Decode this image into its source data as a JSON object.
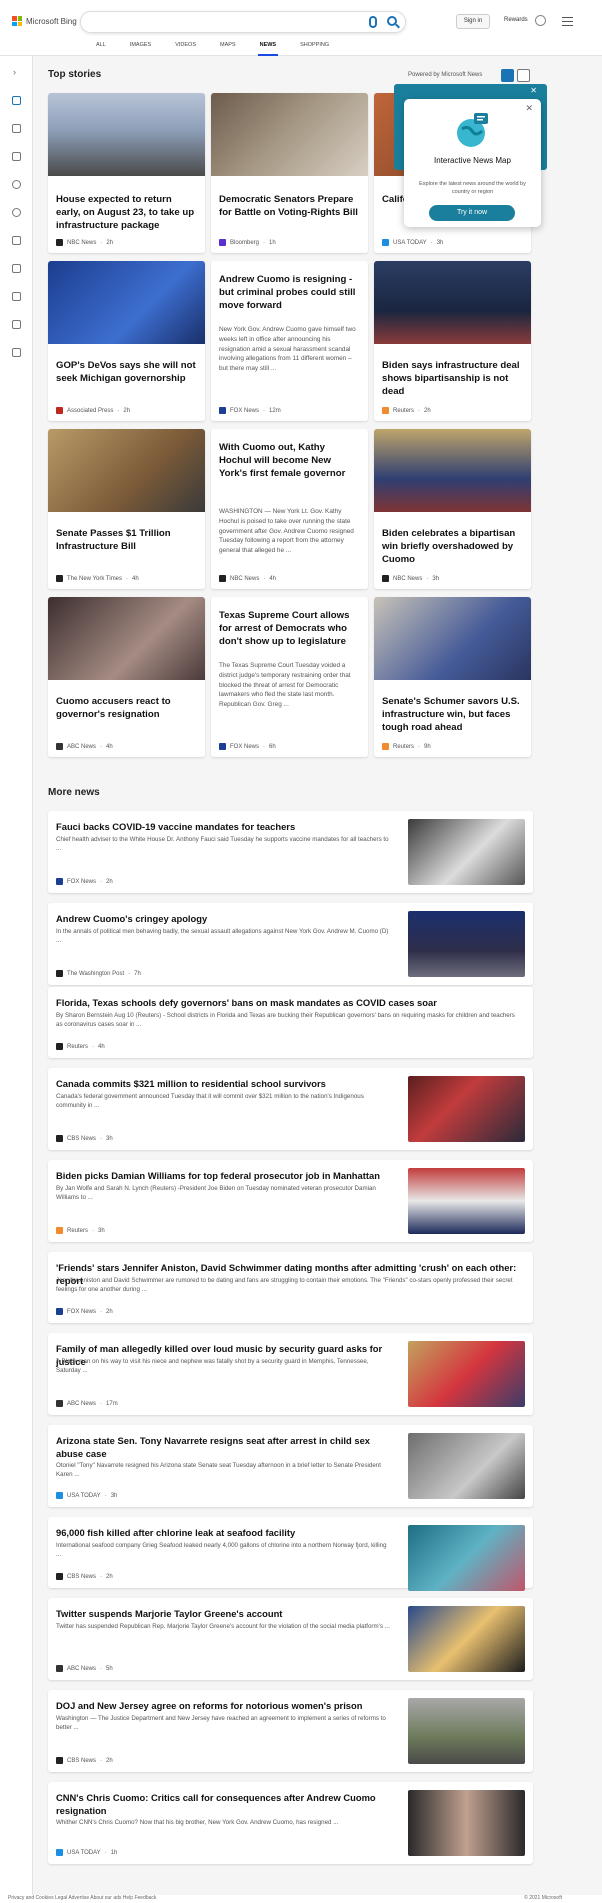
{
  "header": {
    "brand": "Microsoft Bing",
    "signin": "Sign in",
    "rewards": "Rewards",
    "tabs": [
      "ALL",
      "IMAGES",
      "VIDEOS",
      "MAPS",
      "NEWS",
      "SHOPPING"
    ],
    "active_tab": "NEWS"
  },
  "top_stories": {
    "heading": "Top stories",
    "powered_by": "Powered by Microsoft News",
    "cards": [
      {
        "title": "House expected to return early, on August 23, to take up infrastructure package",
        "snippet": "",
        "source": "NBC News",
        "age": "2h",
        "src_color": "#222"
      },
      {
        "title": "Democratic Senators Prepare for Battle on Voting-Rights Bill",
        "snippet": "",
        "source": "Bloomberg",
        "age": "1h",
        "src_color": "#5a2ed0"
      },
      {
        "title": "California ... destr... hot w...",
        "snippet": "",
        "source": "USA TODAY",
        "age": "3h",
        "src_color": "#1a8fe3"
      },
      {
        "title": "GOP's DeVos says she will not seek Michigan governorship",
        "snippet": "",
        "source": "Associated Press",
        "age": "2h",
        "src_color": "#c0281e"
      },
      {
        "title": "Andrew Cuomo is resigning - but criminal probes could still move forward",
        "snippet": "New York Gov. Andrew Cuomo gave himself two weeks left in office after announcing his resignation amid a sexual harassment scandal involving allegations from 11 different women – but there may still ...",
        "source": "FOX News",
        "age": "12m",
        "src_color": "#1c3f94"
      },
      {
        "title": "Biden says infrastructure deal shows bipartisanship is not dead",
        "snippet": "",
        "source": "Reuters",
        "age": "2h",
        "src_color": "#f28b2c"
      },
      {
        "title": "Senate Passes $1 Trillion Infrastructure Bill",
        "snippet": "",
        "source": "The New York Times",
        "age": "4h",
        "src_color": "#222"
      },
      {
        "title": "With Cuomo out, Kathy Hochul will become New York's first female governor",
        "snippet": "WASHINGTON — New York Lt. Gov. Kathy Hochul is poised to take over running the state government after Gov. Andrew Cuomo resigned Tuesday following a report from the attorney general that alleged he ...",
        "source": "NBC News",
        "age": "4h",
        "src_color": "#222"
      },
      {
        "title": "Biden celebrates a bipartisan win briefly overshadowed by Cuomo",
        "snippet": "",
        "source": "NBC News",
        "age": "3h",
        "src_color": "#222"
      },
      {
        "title": "Cuomo accusers react to governor's resignation",
        "snippet": "",
        "source": "ABC News",
        "age": "4h",
        "src_color": "#333"
      },
      {
        "title": "Texas Supreme Court allows for arrest of Democrats who don't show up to legislature",
        "snippet": "The Texas Supreme Court Tuesday voided a district judge's temporary restraining order that blocked the threat of arrest for Democratic lawmakers who fled the state last month.  Republican Gov. Greg ...",
        "source": "FOX News",
        "age": "6h",
        "src_color": "#1c3f94"
      },
      {
        "title": "Senate's Schumer savors U.S. infrastructure win, but faces tough road ahead",
        "snippet": "",
        "source": "Reuters",
        "age": "9h",
        "src_color": "#f28b2c"
      }
    ]
  },
  "popup": {
    "title": "Interactive News Map",
    "description": "Explore the latest news around the world by country or region",
    "button": "Try it now",
    "close": "✕"
  },
  "more_news": {
    "heading": "More news",
    "items": [
      {
        "title": "Fauci backs COVID-19 vaccine mandates for teachers",
        "snippet": "Chief health adviser to the White House Dr. Anthony Fauci said Tuesday he supports vaccine mandates for all teachers to ...",
        "source": "FOX News",
        "age": "2h",
        "src_color": "#1c3f94"
      },
      {
        "title": "Andrew Cuomo's cringey apology",
        "snippet": "In the annals of political men behaving badly, the sexual assault allegations against New York Gov. Andrew M. Cuomo (D) ...",
        "source": "The Washington Post",
        "age": "7h",
        "src_color": "#222"
      },
      {
        "title": "Florida, Texas schools defy governors' bans on mask mandates as COVID cases soar",
        "snippet": "By Sharon Bernstein Aug 10 (Reuters) - School districts in Florida and Texas are bucking their Republican governors' bans on requiring masks for children and teachers as coronavirus cases soar in ...",
        "source": "Reuters",
        "age": "4h",
        "src_color": "#222"
      },
      {
        "title": "Canada commits $321 million to residential school survivors",
        "snippet": "Canada's federal government announced Tuesday that it will commit over $321 million to the nation's Indigenous community in ...",
        "source": "CBS News",
        "age": "3h",
        "src_color": "#222"
      },
      {
        "title": "Biden picks Damian Williams for top federal prosecutor job in Manhattan",
        "snippet": "By Jan Wolfe and Sarah N. Lynch (Reuters) -President Joe Biden on Tuesday nominated veteran prosecutor Damian Williams to ...",
        "source": "Reuters",
        "age": "3h",
        "src_color": "#f28b2c"
      },
      {
        "title": "'Friends' stars Jennifer Aniston, David Schwimmer dating months after admitting 'crush' on each other: report",
        "snippet": "Jennifer Aniston and David Schwimmer are rumored to be dating and fans are struggling to contain their emotions. The \"Friends\" co-stars openly professed their secret feelings for one another during ...",
        "source": "FOX News",
        "age": "2h",
        "src_color": "#1c3f94"
      },
      {
        "title": "Family of man allegedly killed over loud music by security guard asks for justice",
        "snippet": "A Black man on his way to visit his niece and nephew was fatally shot by a security guard in Memphis, Tennessee, Saturday ...",
        "source": "ABC News",
        "age": "17m",
        "src_color": "#333"
      },
      {
        "title": "Arizona state Sen. Tony Navarrete resigns seat after arrest in child sex abuse case",
        "snippet": "Otoniel \"Tony\" Navarrete resigned his Arizona state Senate seat Tuesday afternoon in a brief letter to Senate President Karen ...",
        "source": "USA TODAY",
        "age": "3h",
        "src_color": "#1a8fe3"
      },
      {
        "title": "96,000 fish killed after chlorine leak at seafood facility",
        "snippet": "International seafood company Grieg Seafood leaked nearly 4,000 gallons of chlorine into a northern Norway fjord, killing ...",
        "source": "CBS News",
        "age": "2h",
        "src_color": "#222"
      },
      {
        "title": "Twitter suspends Marjorie Taylor Greene's account",
        "snippet": "Twitter has suspended Republican Rep. Marjorie Taylor Greene's account for the violation of the social media platform's ...",
        "source": "ABC News",
        "age": "5h",
        "src_color": "#333"
      },
      {
        "title": "DOJ and New Jersey agree on reforms for notorious women's prison",
        "snippet": "Washington — The Justice Department and New Jersey have reached an agreement to implement a series of reforms to better ...",
        "source": "CBS News",
        "age": "2h",
        "src_color": "#222"
      },
      {
        "title": "CNN's Chris Cuomo: Critics call for consequences after Andrew Cuomo resignation",
        "snippet": "Whither CNN's Chris Cuomo? Now that his big brother, New York Gov. Andrew Cuomo, has resigned ...",
        "source": "USA TODAY",
        "age": "1h",
        "src_color": "#1a8fe3"
      }
    ]
  },
  "footer": {
    "text": "Privacy and Cookies   Legal   Advertise   About our ads   Help   Feedback",
    "copyright": "© 2021 Microsoft"
  }
}
